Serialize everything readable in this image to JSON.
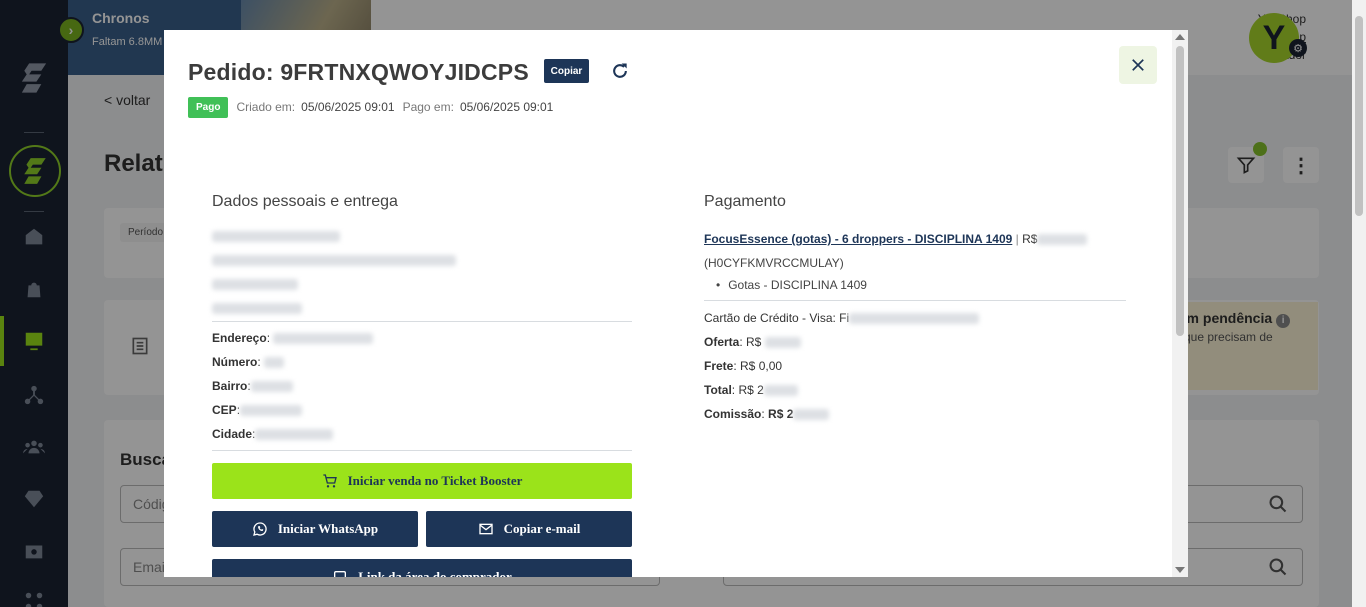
{
  "app": {
    "banner_title": "Chronos",
    "banner_sub": "Faltam 6.8MM",
    "user_brand": "YouShop",
    "user_link": "YouShop",
    "user_role": "istrador",
    "avatar_letter": "Y"
  },
  "background": {
    "back_label": "< voltar",
    "heading": "Relat",
    "periodo_label": "Período",
    "pending_title": "om pendência",
    "pending_sub": "que precisam de",
    "search_heading": "Busca",
    "input_code_placeholder": "Códig",
    "input_email_placeholder": "Emai"
  },
  "modal": {
    "title": "Pedido: 9FRTNXQWOYJIDCPS",
    "copy_label": "Copiar",
    "status_badge": "Pago",
    "created_label": "Criado em:",
    "created_value": "05/06/2025 09:01",
    "paid_label": "Pago em:",
    "paid_value": "05/06/2025 09:01",
    "personal": {
      "title": "Dados pessoais e entrega",
      "address_label": "Endereço",
      "number_label": "Número",
      "district_label": "Bairro",
      "zip_label": "CEP",
      "city_label": "Cidade"
    },
    "actions": {
      "ticket_booster": "Iniciar venda no Ticket Booster",
      "whatsapp": "Iniciar WhatsApp",
      "copy_email": "Copiar e-mail",
      "buyer_area_link": "Link da área do comprador"
    },
    "payment": {
      "title": "Pagamento",
      "product_link": "FocusEssence (gotas) - 6 droppers - DISCIPLINA 1409",
      "product_price_prefix": "R$",
      "product_code": "(H0CYFKMVRCCMULAY)",
      "product_item": "Gotas - DISCIPLINA 1409",
      "card_info": "Cartão de Crédito - Visa: Fi",
      "offer_label": "Oferta",
      "offer_prefix": "R$",
      "shipping_label": "Frete",
      "shipping_value": "R$ 0,00",
      "total_label": "Total",
      "total_prefix": "R$ 2",
      "commission_label": "Comissão",
      "commission_prefix": "R$ 2"
    }
  }
}
